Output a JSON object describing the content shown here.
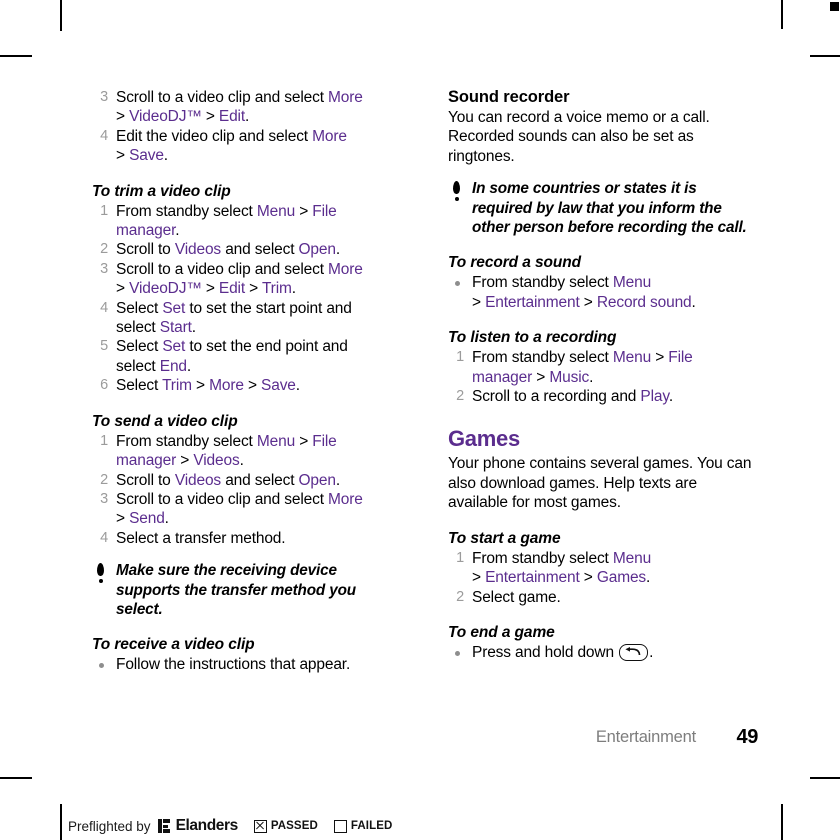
{
  "page": {
    "chapter": "Entertainment",
    "number": "49",
    "accent_color": "#5b2d8e",
    "number_color": "#9b9b9b"
  },
  "left_column": {
    "top_steps": [
      {
        "num": "3",
        "lines": [
          [
            {
              "t": "Scroll to a video clip and select ",
              "c": "black"
            },
            {
              "t": "More",
              "c": "purple"
            }
          ],
          [
            {
              "t": "> ",
              "c": "black"
            },
            {
              "t": "VideoDJ™",
              "c": "purple"
            },
            {
              "t": " > ",
              "c": "black"
            },
            {
              "t": "Edit",
              "c": "purple"
            },
            {
              "t": ".",
              "c": "black"
            }
          ]
        ]
      },
      {
        "num": "4",
        "lines": [
          [
            {
              "t": "Edit the video clip and select ",
              "c": "black"
            },
            {
              "t": "More",
              "c": "purple"
            }
          ],
          [
            {
              "t": "> ",
              "c": "black"
            },
            {
              "t": "Save",
              "c": "purple"
            },
            {
              "t": ".",
              "c": "black"
            }
          ]
        ]
      }
    ],
    "trim_heading": "To trim a video clip",
    "trim_steps": [
      {
        "num": "1",
        "lines": [
          [
            {
              "t": "From standby select ",
              "c": "black"
            },
            {
              "t": "Menu",
              "c": "purple"
            },
            {
              "t": " > ",
              "c": "black"
            },
            {
              "t": "File",
              "c": "purple"
            }
          ],
          [
            {
              "t": "manager",
              "c": "purple"
            },
            {
              "t": ".",
              "c": "black"
            }
          ]
        ]
      },
      {
        "num": "2",
        "lines": [
          [
            {
              "t": "Scroll to ",
              "c": "black"
            },
            {
              "t": "Videos",
              "c": "purple"
            },
            {
              "t": " and select ",
              "c": "black"
            },
            {
              "t": "Open",
              "c": "purple"
            },
            {
              "t": ".",
              "c": "black"
            }
          ]
        ]
      },
      {
        "num": "3",
        "lines": [
          [
            {
              "t": "Scroll to a video clip and select ",
              "c": "black"
            },
            {
              "t": "More",
              "c": "purple"
            }
          ],
          [
            {
              "t": "> ",
              "c": "black"
            },
            {
              "t": "VideoDJ™",
              "c": "purple"
            },
            {
              "t": " > ",
              "c": "black"
            },
            {
              "t": "Edit",
              "c": "purple"
            },
            {
              "t": " > ",
              "c": "black"
            },
            {
              "t": "Trim",
              "c": "purple"
            },
            {
              "t": ".",
              "c": "black"
            }
          ]
        ]
      },
      {
        "num": "4",
        "lines": [
          [
            {
              "t": "Select ",
              "c": "black"
            },
            {
              "t": "Set",
              "c": "purple"
            },
            {
              "t": " to set the start point and",
              "c": "black"
            }
          ],
          [
            {
              "t": "select ",
              "c": "black"
            },
            {
              "t": "Start",
              "c": "purple"
            },
            {
              "t": ".",
              "c": "black"
            }
          ]
        ]
      },
      {
        "num": "5",
        "lines": [
          [
            {
              "t": "Select ",
              "c": "black"
            },
            {
              "t": "Set",
              "c": "purple"
            },
            {
              "t": " to set the end point and",
              "c": "black"
            }
          ],
          [
            {
              "t": "select ",
              "c": "black"
            },
            {
              "t": "End",
              "c": "purple"
            },
            {
              "t": ".",
              "c": "black"
            }
          ]
        ]
      },
      {
        "num": "6",
        "lines": [
          [
            {
              "t": "Select ",
              "c": "black"
            },
            {
              "t": "Trim",
              "c": "purple"
            },
            {
              "t": " > ",
              "c": "black"
            },
            {
              "t": "More",
              "c": "purple"
            },
            {
              "t": " > ",
              "c": "black"
            },
            {
              "t": "Save",
              "c": "purple"
            },
            {
              "t": ".",
              "c": "black"
            }
          ]
        ]
      }
    ],
    "send_heading": "To send a video clip",
    "send_steps": [
      {
        "num": "1",
        "lines": [
          [
            {
              "t": "From standby select ",
              "c": "black"
            },
            {
              "t": "Menu",
              "c": "purple"
            },
            {
              "t": " > ",
              "c": "black"
            },
            {
              "t": "File",
              "c": "purple"
            }
          ],
          [
            {
              "t": "manager",
              "c": "purple"
            },
            {
              "t": " > ",
              "c": "black"
            },
            {
              "t": "Videos",
              "c": "purple"
            },
            {
              "t": ".",
              "c": "black"
            }
          ]
        ]
      },
      {
        "num": "2",
        "lines": [
          [
            {
              "t": "Scroll to ",
              "c": "black"
            },
            {
              "t": "Videos",
              "c": "purple"
            },
            {
              "t": " and select ",
              "c": "black"
            },
            {
              "t": "Open",
              "c": "purple"
            },
            {
              "t": ".",
              "c": "black"
            }
          ]
        ]
      },
      {
        "num": "3",
        "lines": [
          [
            {
              "t": "Scroll to a video clip and select ",
              "c": "black"
            },
            {
              "t": "More",
              "c": "purple"
            }
          ],
          [
            {
              "t": "> ",
              "c": "black"
            },
            {
              "t": "Send",
              "c": "purple"
            },
            {
              "t": ".",
              "c": "black"
            }
          ]
        ]
      },
      {
        "num": "4",
        "lines": [
          [
            {
              "t": "Select a transfer method.",
              "c": "black"
            }
          ]
        ]
      }
    ],
    "note": "Make sure the receiving device supports the transfer method you select.",
    "receive_heading": "To receive a video clip",
    "receive_bullet": "Follow the instructions that appear."
  },
  "right_column": {
    "sound_recorder_heading": "Sound recorder",
    "sound_recorder_body": "You can record a voice memo or a call. Recorded sounds can also be set as ringtones.",
    "note": "In some countries or states it is required by law that you inform the other person before recording the call.",
    "record_heading": "To record a sound",
    "record_bullet": [
      [
        {
          "t": "From standby select ",
          "c": "black"
        },
        {
          "t": "Menu",
          "c": "purple"
        }
      ],
      [
        {
          "t": "> ",
          "c": "black"
        },
        {
          "t": "Entertainment",
          "c": "purple"
        },
        {
          "t": " > ",
          "c": "black"
        },
        {
          "t": "Record sound",
          "c": "purple"
        },
        {
          "t": ".",
          "c": "black"
        }
      ]
    ],
    "listen_heading": "To listen to a recording",
    "listen_steps": [
      {
        "num": "1",
        "lines": [
          [
            {
              "t": "From standby select ",
              "c": "black"
            },
            {
              "t": "Menu",
              "c": "purple"
            },
            {
              "t": " > ",
              "c": "black"
            },
            {
              "t": "File",
              "c": "purple"
            }
          ],
          [
            {
              "t": "manager",
              "c": "purple"
            },
            {
              "t": " > ",
              "c": "black"
            },
            {
              "t": "Music",
              "c": "purple"
            },
            {
              "t": ".",
              "c": "black"
            }
          ]
        ]
      },
      {
        "num": "2",
        "lines": [
          [
            {
              "t": "Scroll to a recording and ",
              "c": "black"
            },
            {
              "t": "Play",
              "c": "purple"
            },
            {
              "t": ".",
              "c": "black"
            }
          ]
        ]
      }
    ],
    "games_heading": "Games",
    "games_body": "Your phone contains several games. You can also download games. Help texts are available for most games.",
    "start_heading": "To start a game",
    "start_steps": [
      {
        "num": "1",
        "lines": [
          [
            {
              "t": "From standby select ",
              "c": "black"
            },
            {
              "t": "Menu",
              "c": "purple"
            }
          ],
          [
            {
              "t": "> ",
              "c": "black"
            },
            {
              "t": "Entertainment",
              "c": "purple"
            },
            {
              "t": " > ",
              "c": "black"
            },
            {
              "t": "Games",
              "c": "purple"
            },
            {
              "t": ".",
              "c": "black"
            }
          ]
        ]
      },
      {
        "num": "2",
        "lines": [
          [
            {
              "t": "Select game.",
              "c": "black"
            }
          ]
        ]
      }
    ],
    "end_heading": "To end a game",
    "end_bullet_pre": "Press and hold down ",
    "end_bullet_post": ".",
    "end_key_icon": "back-key-icon"
  },
  "preflight": {
    "text": "Preflighted by",
    "brand": "Elanders",
    "passed_label": "PASSED",
    "failed_label": "FAILED",
    "passed_checked": true,
    "failed_checked": false
  }
}
